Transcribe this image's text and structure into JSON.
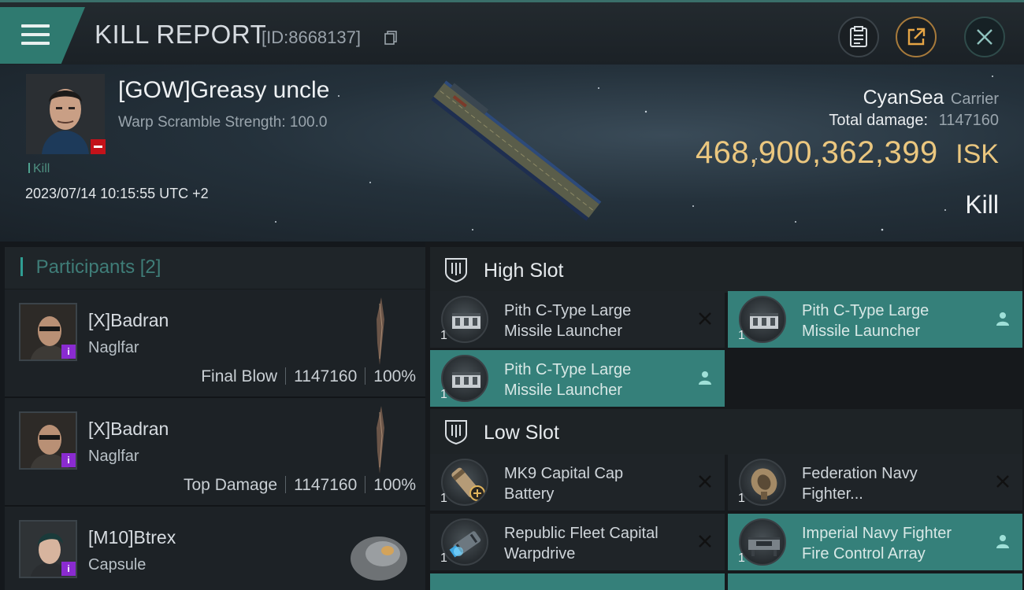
{
  "header": {
    "title": "KILL REPORT",
    "report_id": "[ID:8668137]"
  },
  "victim": {
    "name": "[GOW]Greasy uncle",
    "warp_scramble": "Warp Scramble Strength: 100.0",
    "kill_tag": "Kill",
    "timestamp": "2023/07/14 10:15:55 UTC +2",
    "corp": "CyanSea",
    "ship_class": "Carrier",
    "damage_label": "Total damage:",
    "damage_value": "1147160",
    "isk_value": "468,900,362,399",
    "isk_unit": "ISK",
    "result": "Kill"
  },
  "participants": {
    "label": "Participants",
    "count": "[2]",
    "items": [
      {
        "name": "[X]Badran",
        "ship": "Naglfar",
        "role": "Final Blow",
        "damage": "1147160",
        "percent": "100%",
        "badge": "i"
      },
      {
        "name": "[X]Badran",
        "ship": "Naglfar",
        "role": "Top Damage",
        "damage": "1147160",
        "percent": "100%",
        "badge": "i"
      },
      {
        "name": "[M10]Btrex",
        "ship": "Capsule",
        "role": "",
        "damage": "",
        "percent": "",
        "badge": "i"
      }
    ]
  },
  "slots": {
    "high": {
      "title": "High Slot",
      "modules": [
        {
          "line1": "Pith C-Type Large",
          "line2": "Missile Launcher",
          "qty": "1",
          "status": "destroyed"
        },
        {
          "line1": "Pith C-Type Large",
          "line2": "Missile Launcher",
          "qty": "1",
          "status": "dropped"
        },
        {
          "line1": "Pith C-Type Large",
          "line2": "Missile Launcher",
          "qty": "1",
          "status": "dropped"
        }
      ]
    },
    "low": {
      "title": "Low Slot",
      "modules": [
        {
          "line1": "MK9 Capital Cap",
          "line2": "Battery",
          "qty": "1",
          "status": "destroyed"
        },
        {
          "line1": "Federation Navy",
          "line2": "Fighter...",
          "qty": "1",
          "status": "destroyed"
        },
        {
          "line1": "Republic Fleet Capital",
          "line2": "Warpdrive",
          "qty": "1",
          "status": "destroyed"
        },
        {
          "line1": "Imperial Navy Fighter",
          "line2": "Fire Control Array",
          "qty": "1",
          "status": "dropped"
        }
      ]
    }
  },
  "colors": {
    "accent": "#35807a",
    "isk": "#ebc77f",
    "badge": "#8a2bd0",
    "minus": "#c3121a"
  },
  "icons": [
    "menu-icon",
    "copy-icon",
    "clipboard-icon",
    "share-icon",
    "close-icon",
    "shield-slot-icon",
    "destroyed-x-icon",
    "dropped-person-icon"
  ]
}
